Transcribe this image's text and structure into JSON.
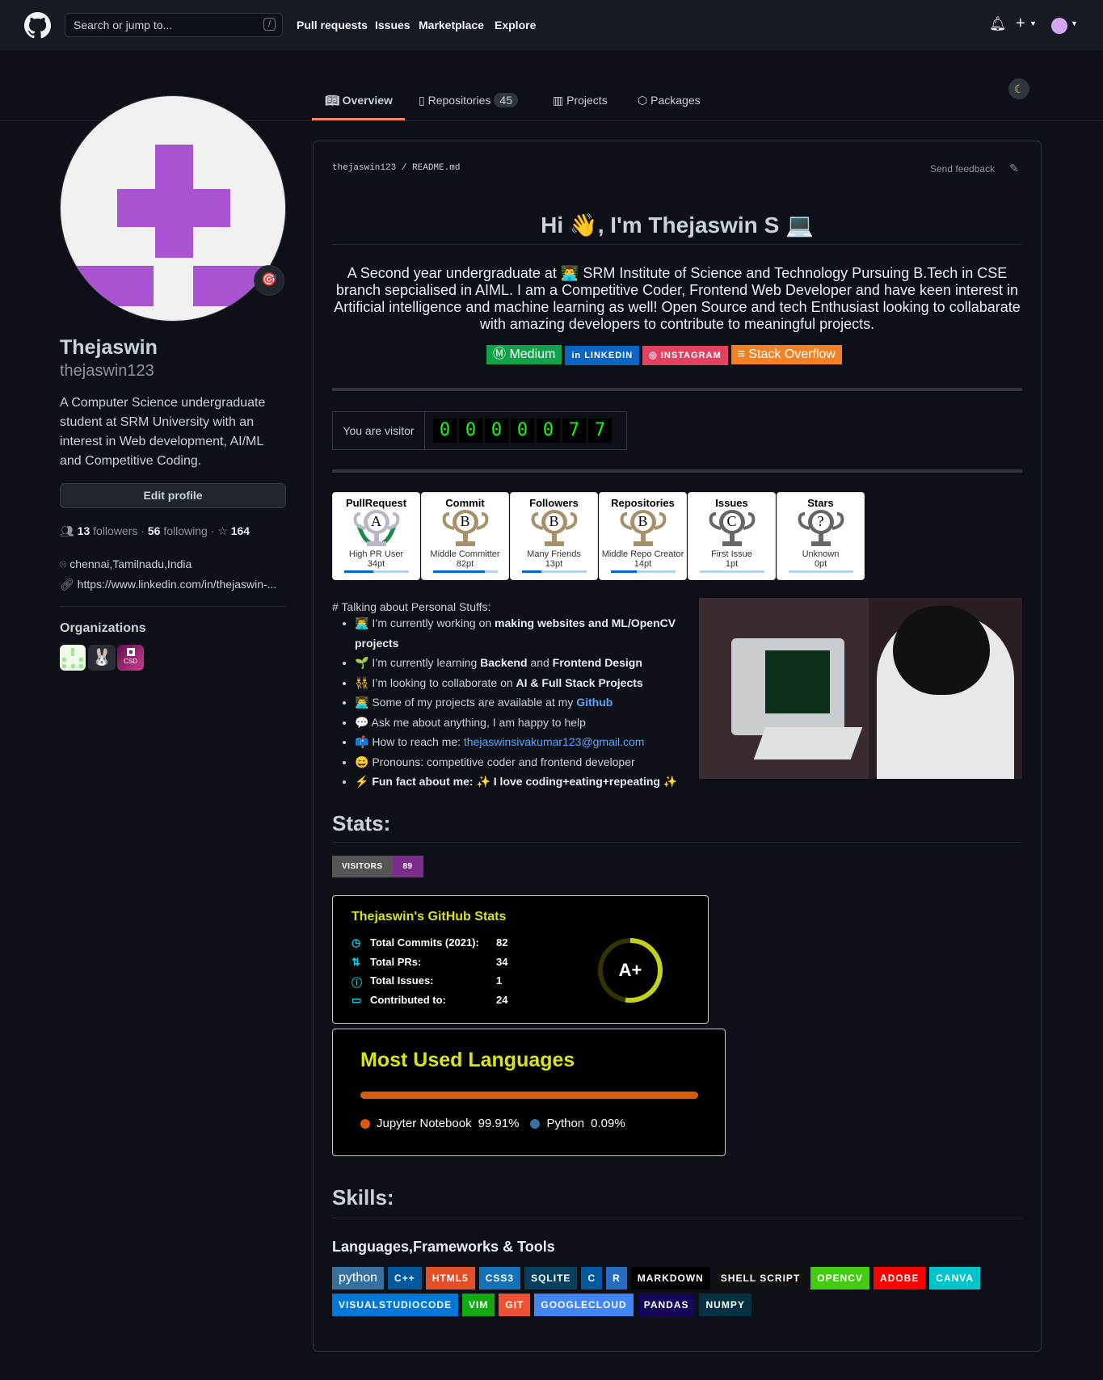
{
  "header": {
    "search_placeholder": "Search or jump to...",
    "slash": "/",
    "nav": [
      "Pull requests",
      "Issues",
      "Marketplace",
      "Explore"
    ],
    "plus": "+"
  },
  "tabs": [
    {
      "label": "Overview"
    },
    {
      "label": "Repositories",
      "count": "45"
    },
    {
      "label": "Projects"
    },
    {
      "label": "Packages"
    }
  ],
  "profile": {
    "name": "Thejaswin",
    "username": "thejaswin123",
    "bio": "A Computer Science undergraduate student at SRM University with an interest in Web development, AI/ML and Competitive Coding.",
    "edit": "Edit profile",
    "followers": "13",
    "followers_label": "followers",
    "following": "56",
    "following_label": "following",
    "stars": "164",
    "location": "chennai,Tamilnadu,India",
    "link": "https://www.linkedin.com/in/thejaswin-...",
    "orgs_title": "Organizations",
    "org_csd": "CSD"
  },
  "readme": {
    "path_user": "thejaswin123",
    "path_file": "README.md",
    "feedback": "Send feedback",
    "title": "Hi 👋, I'm Thejaswin S 💻",
    "intro": "A Second year undergraduate at 👨‍💻 SRM Institute of Science and Technology Pursuing B.Tech in CSE branch sepcialised in AIML. I am a Competitive Coder, Frontend Web Developer and have keen interest in Artificial intelligence and machine learning as well! Open Source and tech Enthusiast looking to collabarate with amazing developers to contribute to meaningful projects.",
    "social": [
      {
        "label": "Medium",
        "color": "#12a24a"
      },
      {
        "label": "LINKEDIN",
        "color": "#0a66c2"
      },
      {
        "label": "INSTAGRAM",
        "color": "#e4405f"
      },
      {
        "label": "Stack Overflow",
        "color": "#f48024"
      }
    ],
    "visitor_label": "You are visitor",
    "visitor_digits": [
      "0",
      "0",
      "0",
      "0",
      "0",
      "7",
      "7"
    ],
    "trophies": [
      {
        "title": "PullRequest",
        "rank": "A",
        "name": "High PR User",
        "pts": "34pt",
        "progress": 0.45
      },
      {
        "title": "Commit",
        "rank": "B",
        "name": "Middle Committer",
        "pts": "82pt",
        "progress": 0.8
      },
      {
        "title": "Followers",
        "rank": "B",
        "name": "Many Friends",
        "pts": "13pt",
        "progress": 0.3
      },
      {
        "title": "Repositories",
        "rank": "B",
        "name": "Middle Repo Creator",
        "pts": "14pt",
        "progress": 0.4
      },
      {
        "title": "Issues",
        "rank": "C",
        "name": "First Issue",
        "pts": "1pt",
        "progress": 0
      },
      {
        "title": "Stars",
        "rank": "?",
        "name": "Unknown",
        "pts": "0pt",
        "progress": 0
      }
    ],
    "personal_heading": "# Talking about Personal Stuffs:",
    "stats_heading": "Stats:",
    "visitors_badge": "VISITORS",
    "visitors_count": "89",
    "stats_card": {
      "title": "Thejaswin's GitHub Stats",
      "rows": [
        {
          "label": "Total Commits (2021):",
          "value": "82"
        },
        {
          "label": "Total PRs:",
          "value": "34"
        },
        {
          "label": "Total Issues:",
          "value": "1"
        },
        {
          "label": "Contributed to:",
          "value": "24"
        }
      ],
      "grade": "A+"
    },
    "langs": {
      "title": "Most Used Languages",
      "items": [
        {
          "name": "Jupyter Notebook",
          "pct": "99.91%",
          "color": "#DA5B0B"
        },
        {
          "name": "Python",
          "pct": "0.09%",
          "color": "#3572A5"
        }
      ]
    },
    "skills_heading": "Skills:",
    "skills_sub": "Languages,Frameworks & Tools",
    "skills": [
      {
        "label": "python",
        "color": "#3670A0"
      },
      {
        "label": "C++",
        "color": "#00599C"
      },
      {
        "label": "HTML5",
        "color": "#E34F26"
      },
      {
        "label": "CSS3",
        "color": "#1572B6"
      },
      {
        "label": "SQLITE",
        "color": "#07405e"
      },
      {
        "label": "C",
        "color": "#00599C"
      },
      {
        "label": "R",
        "color": "#276DC3"
      },
      {
        "label": "MARKDOWN",
        "color": "#000000"
      },
      {
        "label": "SHELL SCRIPT",
        "color": "#121011"
      },
      {
        "label": "OPENCV",
        "color": "#44cc11"
      },
      {
        "label": "ADOBE",
        "color": "#FF0000"
      },
      {
        "label": "CANVA",
        "color": "#00C4CC"
      },
      {
        "label": "VISUALSTUDIOCODE",
        "color": "#0078d7"
      },
      {
        "label": "VIM",
        "color": "#11aa11"
      },
      {
        "label": "GIT",
        "color": "#F05033"
      },
      {
        "label": "GOOGLECLOUD",
        "color": "#4285F4"
      },
      {
        "label": "PANDAS",
        "color": "#150458"
      },
      {
        "label": "NUMPY",
        "color": "#013243"
      }
    ]
  }
}
